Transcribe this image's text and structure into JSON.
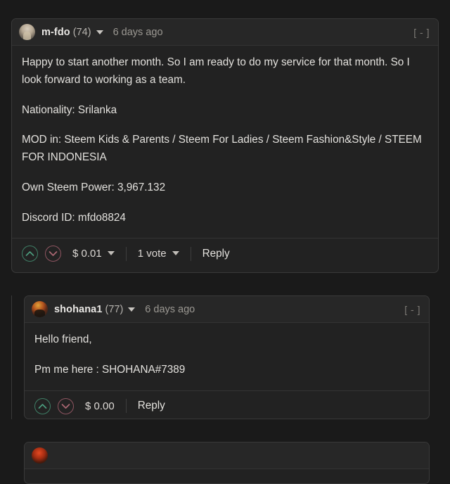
{
  "theme": {
    "page_bg": "#1a1a1a",
    "card_bg": "#222222",
    "header_bg": "#272727",
    "border": "#3a3a3a",
    "text": "#e3e1dd",
    "muted": "#9b9892",
    "upvote_green": "#3f7f66",
    "downvote_red": "#8f5561"
  },
  "comments": [
    {
      "id": "comment-m-fdo",
      "avatar": "avatar-m-fdo",
      "author": "m-fdo",
      "reputation": "(74)",
      "timestamp": "6 days ago",
      "collapse_toggle": "[ - ]",
      "paragraphs": [
        "Happy to start another month. So I am ready to do my service for that month. So I look forward to working as a team.",
        "Nationality: Srilanka",
        "MOD in: Steem Kids & Parents / Steem For Ladies / Steem Fashion&Style / STEEM FOR INDONESIA",
        "Own Steem Power: 3,967.132",
        "Discord ID: mfdo8824"
      ],
      "footer": {
        "upvote_icon": "chevron-up-circle-icon",
        "downvote_icon": "chevron-down-circle-icon",
        "payout": "$ 0.01",
        "payout_has_caret": true,
        "votes": "1 vote",
        "votes_has_caret": true,
        "reply": "Reply"
      }
    },
    {
      "id": "comment-shohana1",
      "avatar": "avatar-shohana1",
      "author": "shohana1",
      "reputation": "(77)",
      "timestamp": "6 days ago",
      "collapse_toggle": "[ - ]",
      "paragraphs": [
        "Hello friend,",
        "Pm me here : SHOHANA#7389"
      ],
      "footer": {
        "upvote_icon": "chevron-up-circle-icon",
        "downvote_icon": "chevron-down-circle-icon",
        "payout": "$ 0.00",
        "payout_has_caret": false,
        "votes": "",
        "votes_has_caret": false,
        "reply": "Reply"
      }
    },
    {
      "id": "comment-partial",
      "avatar": "avatar-partial",
      "author": "",
      "reputation": "",
      "timestamp": "",
      "collapse_toggle": "",
      "paragraphs": [],
      "footer": {
        "upvote_icon": "",
        "downvote_icon": "",
        "payout": "",
        "payout_has_caret": false,
        "votes": "",
        "votes_has_caret": false,
        "reply": ""
      }
    }
  ]
}
